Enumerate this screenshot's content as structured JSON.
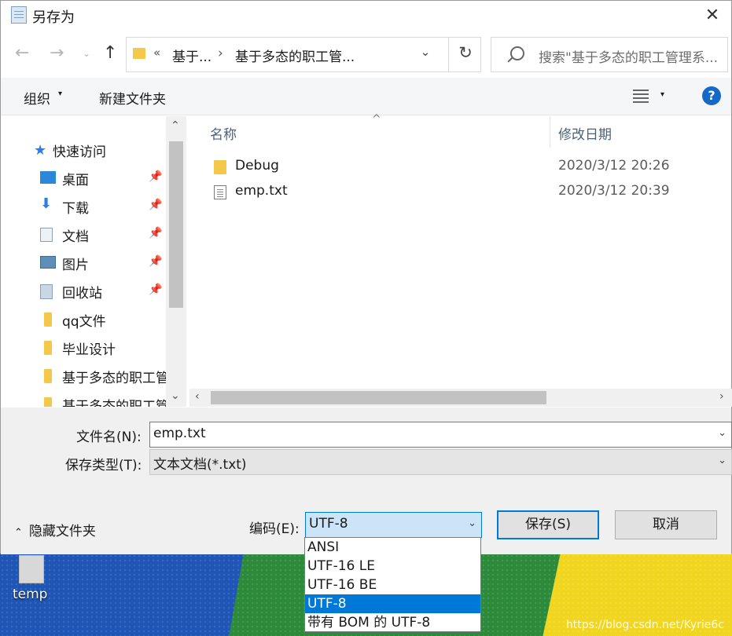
{
  "dialog": {
    "title": "另存为",
    "close_glyph": "✕"
  },
  "nav": {
    "back_glyph": "←",
    "forward_glyph": "→",
    "recent_glyph": "⌄",
    "up_glyph": "↑",
    "refresh_glyph": "↻"
  },
  "address": {
    "chevron": "«",
    "crumbs": [
      "基于...",
      "基于多态的职工管..."
    ],
    "separator": "›",
    "dropdown_glyph": "⌄"
  },
  "search": {
    "placeholder": "搜索\"基于多态的职工管理系..."
  },
  "toolbar": {
    "organize_label": "组织",
    "organize_caret": "▾",
    "new_folder_label": "新建文件夹",
    "view_caret": "▾",
    "help_glyph": "?"
  },
  "navpane": {
    "quick_access_label": "快速访问",
    "items": [
      {
        "label": "桌面",
        "icon": "desktop-icon",
        "pinned": true
      },
      {
        "label": "下载",
        "icon": "download-icon",
        "pinned": true
      },
      {
        "label": "文档",
        "icon": "documents-icon",
        "pinned": true
      },
      {
        "label": "图片",
        "icon": "pictures-icon",
        "pinned": true
      },
      {
        "label": "回收站",
        "icon": "recycle-bin-icon",
        "pinned": true
      },
      {
        "label": "qq文件",
        "icon": "folder-icon",
        "pinned": false
      },
      {
        "label": "毕业设计",
        "icon": "folder-icon",
        "pinned": false
      },
      {
        "label": "基于多态的职工管",
        "icon": "folder-icon",
        "pinned": false
      },
      {
        "label": "基于多态的职工管",
        "icon": "folder-icon",
        "pinned": false
      }
    ],
    "pin_glyph": "📌",
    "scroll_up": "⌃",
    "scroll_down": "⌄"
  },
  "filelist": {
    "sort_glyph": "^",
    "columns": {
      "name": "名称",
      "date": "修改日期"
    },
    "rows": [
      {
        "name": "Debug",
        "date": "2020/3/12 20:26",
        "type": "folder"
      },
      {
        "name": "emp.txt",
        "date": "2020/3/12 20:39",
        "type": "txt"
      }
    ],
    "scroll_left": "‹",
    "scroll_right": "›"
  },
  "form": {
    "filename_label": "文件名(N):",
    "filename_value": "emp.txt",
    "filetype_label": "保存类型(T):",
    "filetype_value": "文本文档(*.txt)",
    "dropdown_glyph": "⌄",
    "hide_folders_label": "隐藏文件夹",
    "hide_caret": "⌃",
    "encoding_label": "编码(E):",
    "encoding_value": "UTF-8",
    "save_label": "保存(S)",
    "cancel_label": "取消"
  },
  "encoding_options": [
    "ANSI",
    "UTF-16 LE",
    "UTF-16 BE",
    "UTF-8",
    "带有 BOM 的 UTF-8"
  ],
  "encoding_selected_index": 3,
  "desktop": {
    "icon_label": "temp",
    "watermark": "https://blog.csdn.net/Kyrie6c"
  },
  "colors": {
    "accent": "#0078d7",
    "folder": "#f4c84b",
    "help": "#1568c6"
  }
}
